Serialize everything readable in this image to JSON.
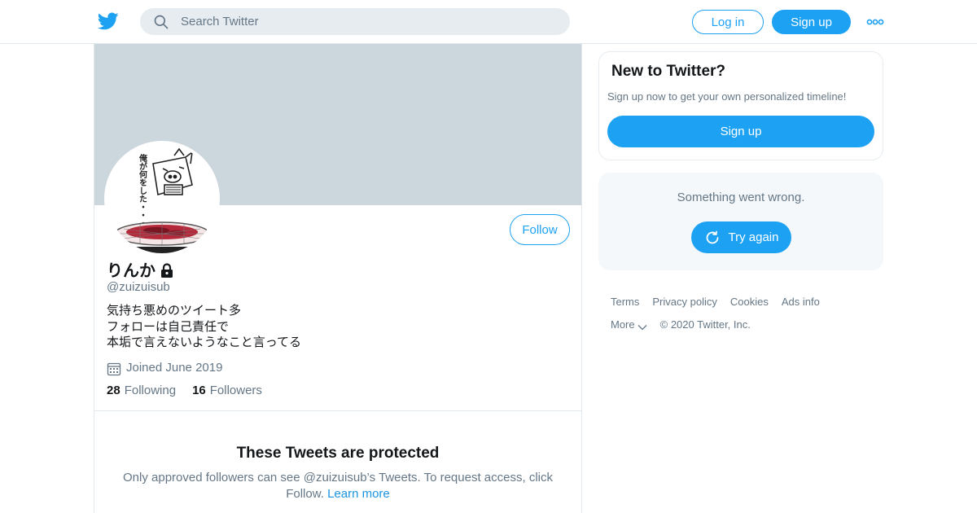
{
  "header": {
    "search_placeholder": "Search Twitter",
    "login_label": "Log in",
    "signup_label": "Sign up"
  },
  "profile": {
    "display_name": "りんか",
    "handle": "@zuizuisub",
    "bio_lines": [
      "気持ち悪めのツイート多",
      "フォローは自己責任で",
      "本垢で言えないようなこと言ってる"
    ],
    "joined": "Joined June 2019",
    "following_count": "28",
    "following_label": "Following",
    "followers_count": "16",
    "followers_label": "Followers",
    "follow_label": "Follow",
    "protected_title": "These Tweets are protected",
    "protected_text": "Only approved followers can see @zuizuisub’s Tweets. To request access, click Follow.",
    "learn_more": "Learn more",
    "avatar_text": "俺が何をした・・・"
  },
  "sidebar": {
    "signup_title": "New to Twitter?",
    "signup_text": "Sign up now to get your own personalized timeline!",
    "signup_button": "Sign up",
    "error_text": "Something went wrong.",
    "retry_label": "Try again"
  },
  "footer": {
    "links": [
      "Terms",
      "Privacy policy",
      "Cookies",
      "Ads info"
    ],
    "more": "More",
    "copyright": "© 2020 Twitter, Inc."
  },
  "colors": {
    "accent": "#1da1f2",
    "banner": "#ccd6dd",
    "secondary_text": "#657786",
    "link": "#1b95e0"
  }
}
